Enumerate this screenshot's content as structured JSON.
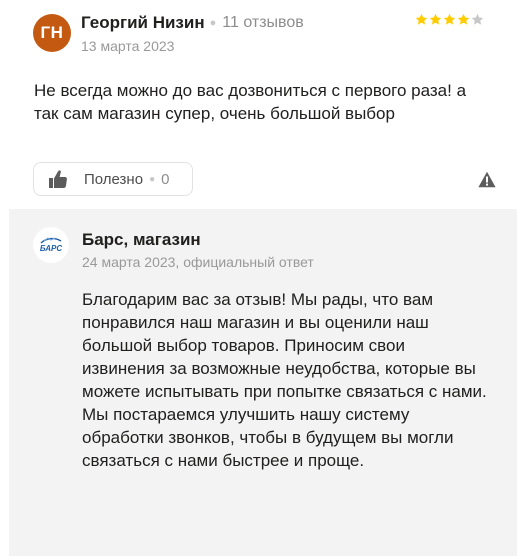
{
  "author": {
    "initials": "ГН",
    "name": "Георгий Низин",
    "review_count": "11 отзывов",
    "date": "13 марта 2023",
    "rating": 4,
    "avatar_color": "#c45a12"
  },
  "review": {
    "text": "Не всегда можно до вас дозвониться с первого раза! а так сам магазин супер, очень большой выбор"
  },
  "actions": {
    "like_label": "Полезно",
    "like_count": "0",
    "thumb_icon": "thumbs-up-icon",
    "report_icon": "warning-triangle-icon"
  },
  "reply": {
    "org_name": "Барс, магазин",
    "logo_text": "БАРС",
    "meta": "24 марта 2023, официальный ответ",
    "text": "Благодарим вас за отзыв! Мы рады, что вам понравился наш магазин и вы оценили наш большой выбор товаров. Приносим свои извинения за возможные неудобства, которые вы можете испытывать при попытке связаться с нами. Мы постараемся улучшить нашу систему обработки звонков, чтобы в будущем вы могли связаться с нами быстрее и проще."
  },
  "colors": {
    "star_filled": "#fc0",
    "star_empty": "#c7c7c7",
    "reply_bg": "#f3f3f3",
    "logo_blue": "#1e5fa8"
  }
}
